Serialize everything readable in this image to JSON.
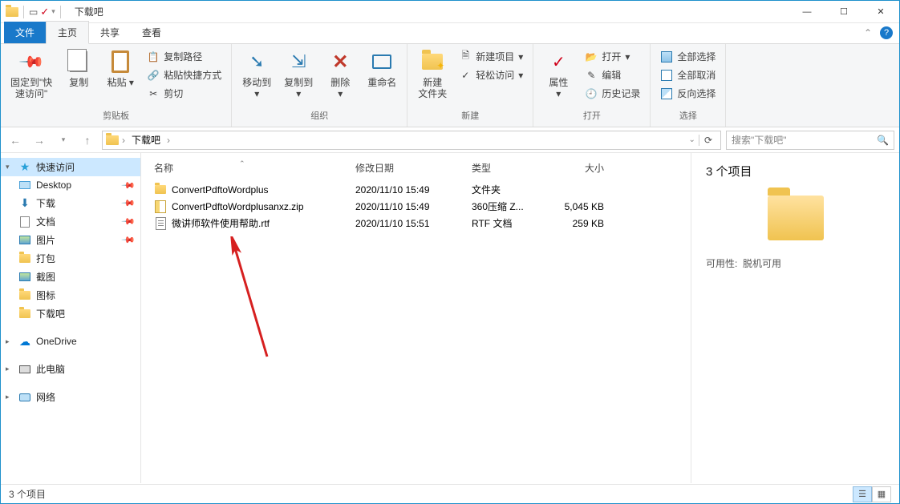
{
  "window": {
    "title": "下载吧"
  },
  "tabs": {
    "file": "文件",
    "home": "主页",
    "share": "共享",
    "view": "查看"
  },
  "ribbon": {
    "pinLabel": "固定到\"快\n速访问\"",
    "copy": "复制",
    "paste": "粘贴",
    "copyPath": "复制路径",
    "pasteShortcut": "粘贴快捷方式",
    "cut": "剪切",
    "groupClipboard": "剪贴板",
    "moveTo": "移动到",
    "copyTo": "复制到",
    "delete": "删除",
    "rename": "重命名",
    "groupOrganize": "组织",
    "newFolder": "新建\n文件夹",
    "newItem": "新建项目",
    "easyAccess": "轻松访问",
    "groupNew": "新建",
    "properties": "属性",
    "open": "打开",
    "edit": "编辑",
    "history": "历史记录",
    "groupOpen": "打开",
    "selectAll": "全部选择",
    "selectNone": "全部取消",
    "invertSel": "反向选择",
    "groupSelect": "选择"
  },
  "address": {
    "root": "下载吧",
    "searchPlaceholder": "搜索\"下载吧\""
  },
  "sidebar": {
    "quickAccess": "快速访问",
    "desktop": "Desktop",
    "downloads": "下载",
    "documents": "文档",
    "pictures": "图片",
    "dabao": "打包",
    "jietu": "截图",
    "tubiao": "图标",
    "xiazaiba": "下载吧",
    "onedrive": "OneDrive",
    "thisPC": "此电脑",
    "network": "网络"
  },
  "columns": {
    "name": "名称",
    "date": "修改日期",
    "type": "类型",
    "size": "大小"
  },
  "files": [
    {
      "name": "ConvertPdftoWordplus",
      "date": "2020/11/10 15:49",
      "type": "文件夹",
      "size": ""
    },
    {
      "name": "ConvertPdftoWordplusanxz.zip",
      "date": "2020/11/10 15:49",
      "type": "360压缩 Z...",
      "size": "5,045 KB"
    },
    {
      "name": "微讲师软件使用帮助.rtf",
      "date": "2020/11/10 15:51",
      "type": "RTF 文档",
      "size": "259 KB"
    }
  ],
  "details": {
    "count": "3 个项目",
    "availLabel": "可用性:",
    "availValue": "脱机可用"
  },
  "status": {
    "text": "3 个项目"
  }
}
